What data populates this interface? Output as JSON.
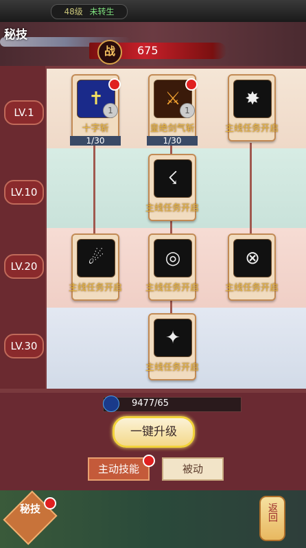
{
  "top": {
    "level": "48级",
    "rebirth": "未转生"
  },
  "header": {
    "title": "秘技",
    "power_label": "战",
    "power_value": "675"
  },
  "levels": [
    "LV.1",
    "LV.10",
    "LV.20",
    "LV.30"
  ],
  "skills": [
    {
      "name": "十字斩",
      "progress": "1/30",
      "badge": "1",
      "icon": "cross-icon"
    },
    {
      "name": "皇绝剑气斩",
      "progress": "1/30",
      "badge": "1",
      "icon": "sword-icon"
    },
    {
      "name": "主线任务开启",
      "icon": "flame-claw-icon"
    },
    {
      "name": "主线任务开启",
      "icon": "slash-icon"
    },
    {
      "name": "主线任务开启",
      "icon": "wind-icon"
    },
    {
      "name": "主线任务开启",
      "icon": "ring-icon"
    },
    {
      "name": "主线任务开启",
      "icon": "blade-orb-icon"
    },
    {
      "name": "主线任务开启",
      "icon": "sword-rain-icon"
    }
  ],
  "energy": {
    "value": "9477/65"
  },
  "buttons": {
    "upgrade": "一键升级",
    "tab_active": "主动技能",
    "tab_passive": "被动",
    "footer": "秘技",
    "back": "返回"
  }
}
